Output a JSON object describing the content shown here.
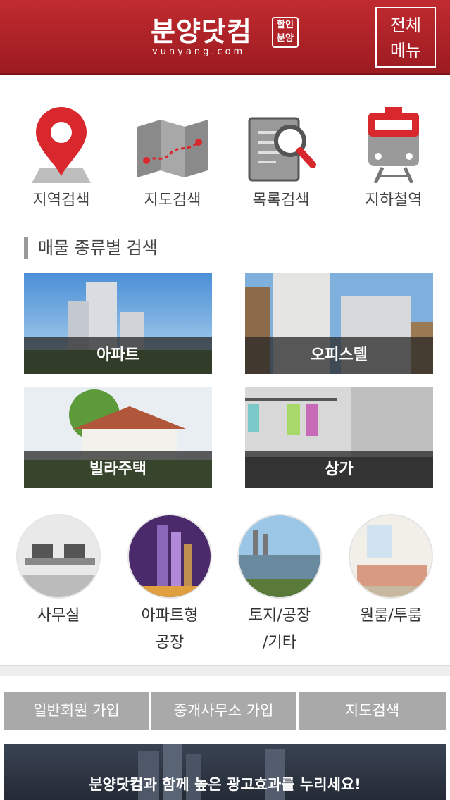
{
  "header": {
    "logo_text": "분양닷컴",
    "logo_badge_line1": "할인",
    "logo_badge_line2": "분양",
    "logo_sub": "vunyang.com",
    "menu_line1": "전체",
    "menu_line2": "메뉴",
    "brand_color": "#b1242a"
  },
  "search_menu": [
    {
      "label": "지역검색",
      "icon": "map-pin-icon"
    },
    {
      "label": "지도검색",
      "icon": "folded-map-icon"
    },
    {
      "label": "목록검색",
      "icon": "magnifier-document-icon"
    },
    {
      "label": "지하철역",
      "icon": "subway-train-icon"
    }
  ],
  "section_title": "매물 종류별 검색",
  "property_types": [
    {
      "label": "아파트"
    },
    {
      "label": "오피스텔"
    },
    {
      "label": "빌라주택"
    },
    {
      "label": "상가"
    }
  ],
  "categories": [
    {
      "line1": "사무실",
      "line2": ""
    },
    {
      "line1": "아파트형",
      "line2": "공장"
    },
    {
      "line1": "토지/공장",
      "line2": "/기타"
    },
    {
      "line1": "원룸/투룸",
      "line2": ""
    }
  ],
  "join_bar": [
    {
      "label": "일반회원 가입"
    },
    {
      "label": "중개사무소 가입"
    },
    {
      "label": "지도검색"
    }
  ],
  "banner_text": "분양닷컴과 함께 높은 광고효과를 누리세요!"
}
